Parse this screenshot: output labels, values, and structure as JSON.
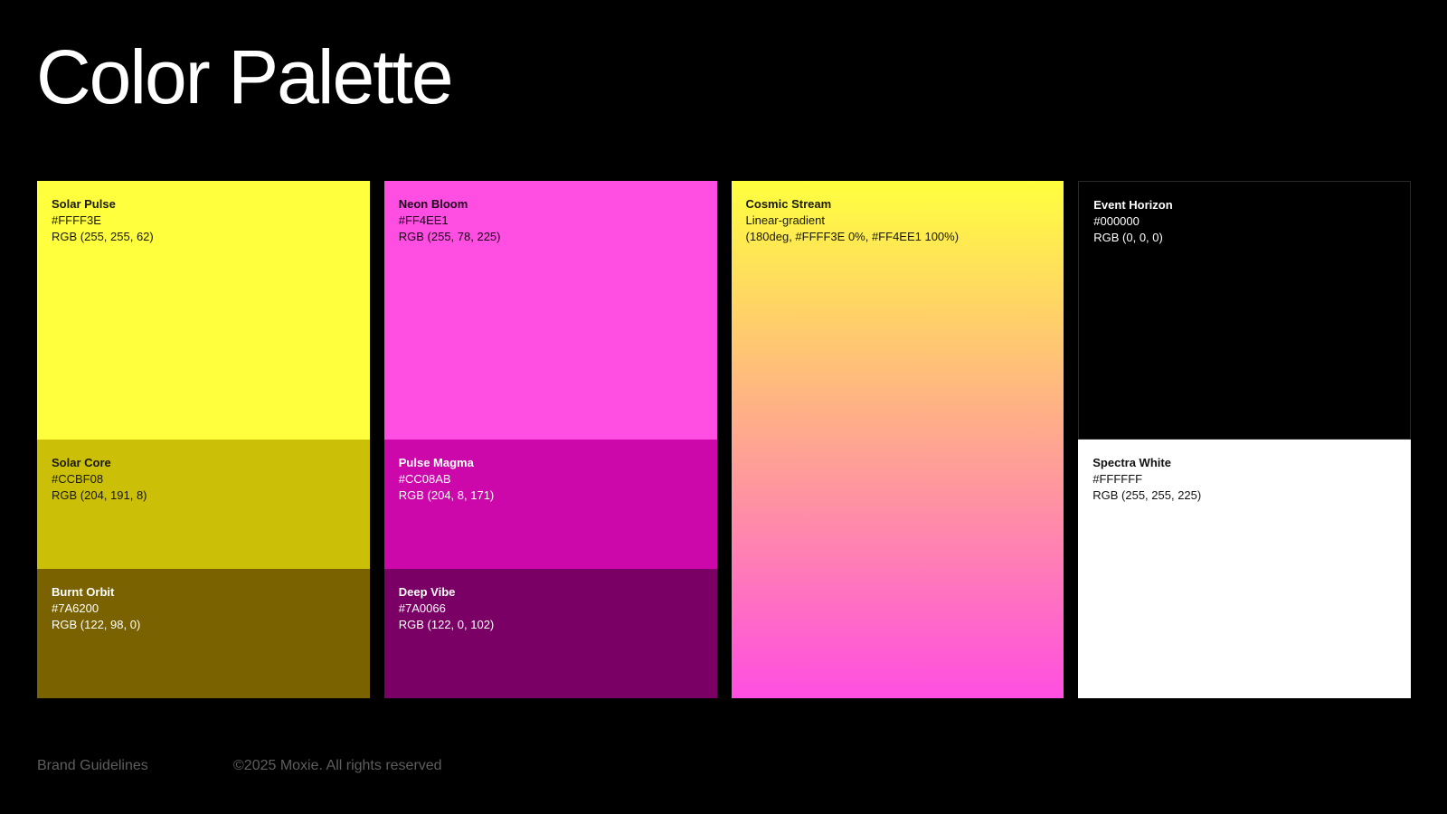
{
  "title": "Color Palette",
  "columns": [
    {
      "swatches": [
        {
          "name": "Solar Pulse",
          "hex": "#FFFF3E",
          "rgb": "RGB (255, 255, 62)",
          "bg": "#FFFF3E",
          "text_color": "#1A1A00"
        },
        {
          "name": "Solar Core",
          "hex": "#CCBF08",
          "rgb": "RGB (204, 191, 8)",
          "bg": "#CCBF08",
          "text_color": "#1A1A00"
        },
        {
          "name": "Burnt Orbit",
          "hex": "#7A6200",
          "rgb": "RGB (122, 98, 0)",
          "bg": "#7A6200",
          "text_color": "#FFFFFF"
        }
      ]
    },
    {
      "swatches": [
        {
          "name": "Neon Bloom",
          "hex": "#FF4EE1",
          "rgb": "RGB (255, 78, 225)",
          "bg": "#FF4EE1",
          "text_color": "#1A001A"
        },
        {
          "name": "Pulse Magma",
          "hex": "#CC08AB",
          "rgb": "RGB (204, 8, 171)",
          "bg": "#CC08AB",
          "text_color": "#FFFFFF"
        },
        {
          "name": "Deep Vibe",
          "hex": "#7A0066",
          "rgb": "RGB (122, 0, 102)",
          "bg": "#7A0066",
          "text_color": "#FFFFFF"
        }
      ]
    },
    {
      "swatches": [
        {
          "name": "Cosmic Stream",
          "type_label": "Linear-gradient",
          "gradient": "(180deg, #FFFF3E 0%, #FF4EE1 100%)",
          "gradient_from": "#FFFF3E",
          "gradient_to": "#FF4EE1",
          "text_color": "#1A1A00"
        }
      ]
    },
    {
      "swatches": [
        {
          "name": "Event Horizon",
          "hex": "#000000",
          "rgb": "RGB (0, 0, 0)",
          "bg": "#000000",
          "text_color": "#FFFFFF"
        },
        {
          "name": "Spectra White",
          "hex": "#FFFFFF",
          "rgb": "RGB (255, 255, 225)",
          "bg": "#FFFFFF",
          "text_color": "#111111"
        }
      ]
    }
  ],
  "footer": {
    "left": "Brand Guidelines",
    "right": "©2025 Moxie. All rights reserved"
  }
}
